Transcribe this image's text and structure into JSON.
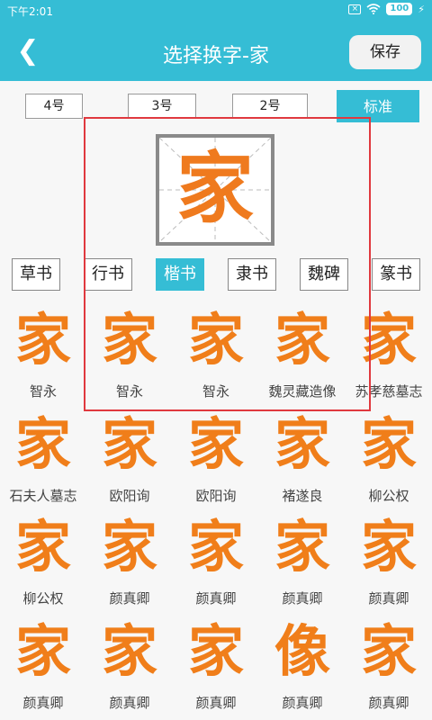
{
  "status_bar": {
    "time": "下午2:01",
    "battery": "100",
    "sim_icon": "x-box-icon",
    "wifi_icon": "wifi-icon",
    "charging_icon": "bolt-icon"
  },
  "header": {
    "back_icon": "chevron-left-icon",
    "back_glyph": "❮",
    "title": "选择换字-家",
    "save_label": "保存"
  },
  "size_options": [
    {
      "label": "4号"
    },
    {
      "label": "3号"
    },
    {
      "label": "2号"
    },
    {
      "label": "标准",
      "active": true
    }
  ],
  "preview": {
    "character": "家"
  },
  "style_tabs": [
    {
      "label": "草书"
    },
    {
      "label": "行书"
    },
    {
      "label": "楷书",
      "active": true
    },
    {
      "label": "隶书"
    },
    {
      "label": "魏碑"
    },
    {
      "label": "篆书"
    }
  ],
  "variants": [
    {
      "character": "家",
      "source": "智永"
    },
    {
      "character": "家",
      "source": "智永"
    },
    {
      "character": "家",
      "source": "智永"
    },
    {
      "character": "家",
      "source": "魏灵藏造像"
    },
    {
      "character": "家",
      "source": "苏孝慈墓志"
    },
    {
      "character": "家",
      "source": "石夫人墓志"
    },
    {
      "character": "家",
      "source": "欧阳询"
    },
    {
      "character": "家",
      "source": "欧阳询"
    },
    {
      "character": "家",
      "source": "褚遂良"
    },
    {
      "character": "家",
      "source": "柳公权"
    },
    {
      "character": "家",
      "source": "柳公权"
    },
    {
      "character": "家",
      "source": "颜真卿"
    },
    {
      "character": "家",
      "source": "颜真卿"
    },
    {
      "character": "家",
      "source": "颜真卿"
    },
    {
      "character": "家",
      "source": "颜真卿"
    },
    {
      "character": "家",
      "source": "颜真卿"
    },
    {
      "character": "家",
      "source": "颜真卿"
    },
    {
      "character": "家",
      "source": "颜真卿"
    },
    {
      "character": "像",
      "source": "颜真卿"
    },
    {
      "character": "家",
      "source": "颜真卿"
    }
  ],
  "colors": {
    "accent": "#35bdd5",
    "glyph": "#f07e1a",
    "highlight": "#e0393f"
  }
}
